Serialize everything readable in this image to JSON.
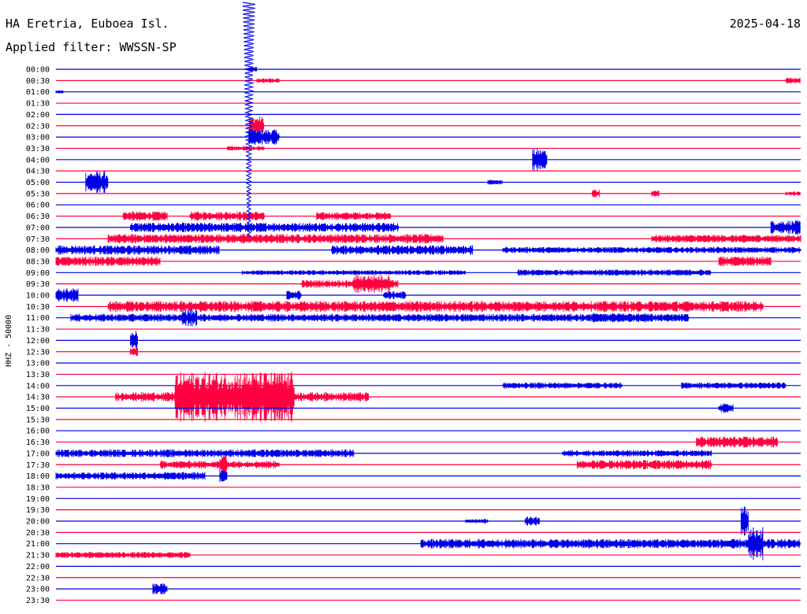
{
  "header": {
    "station": "HA Eretria, Euboea Isl.",
    "filter": "Applied filter: WWSSN-SP",
    "date": "2025-04-18"
  },
  "y_axis_label": "HHZ - 50000",
  "colors": {
    "even_trace": "#0000e6",
    "odd_trace": "#ff0040",
    "text": "#000000",
    "background": "#ffffff"
  },
  "chart_data": {
    "type": "line",
    "title": "HA Eretria, Euboea Isl.",
    "ylabel": "HHZ - 50000",
    "rows": [
      "00:00",
      "00:30",
      "01:00",
      "01:30",
      "02:00",
      "02:30",
      "03:00",
      "03:30",
      "04:00",
      "04:30",
      "05:00",
      "05:30",
      "06:00",
      "06:30",
      "07:00",
      "07:30",
      "08:00",
      "08:30",
      "09:00",
      "09:30",
      "10:00",
      "10:30",
      "11:00",
      "11:30",
      "12:00",
      "12:30",
      "13:00",
      "13:30",
      "14:00",
      "14:30",
      "15:00",
      "15:30",
      "16:00",
      "16:30",
      "17:00",
      "17:30",
      "18:00",
      "18:30",
      "19:00",
      "19:30",
      "20:00",
      "20:30",
      "21:00",
      "21:30",
      "22:00",
      "22:30",
      "23:00",
      "23:30"
    ],
    "trace_colors": [
      "#0000e6",
      "#ff0040"
    ],
    "events": [
      {
        "row": 0,
        "start": 0.26,
        "end": 0.27,
        "amp": 3
      },
      {
        "row": 1,
        "start": 0.27,
        "end": 0.3,
        "amp": 3
      },
      {
        "row": 1,
        "start": 0.98,
        "end": 1.0,
        "amp": 4
      },
      {
        "row": 2,
        "start": 0.0,
        "end": 0.01,
        "amp": 3
      },
      {
        "row": 5,
        "start": 0.26,
        "end": 0.28,
        "amp": 12
      },
      {
        "row": 6,
        "start": 0.26,
        "end": 0.3,
        "amp": 10
      },
      {
        "row": 7,
        "start": 0.23,
        "end": 0.28,
        "amp": 3
      },
      {
        "row": 8,
        "start": 0.64,
        "end": 0.66,
        "amp": 14
      },
      {
        "row": 10,
        "start": 0.04,
        "end": 0.07,
        "amp": 14
      },
      {
        "row": 10,
        "start": 0.58,
        "end": 0.6,
        "amp": 3
      },
      {
        "row": 11,
        "start": 0.72,
        "end": 0.73,
        "amp": 5
      },
      {
        "row": 11,
        "start": 0.8,
        "end": 0.81,
        "amp": 4
      },
      {
        "row": 11,
        "start": 0.98,
        "end": 1.0,
        "amp": 3
      },
      {
        "row": 13,
        "start": 0.09,
        "end": 0.15,
        "amp": 6
      },
      {
        "row": 13,
        "start": 0.18,
        "end": 0.28,
        "amp": 6
      },
      {
        "row": 13,
        "start": 0.35,
        "end": 0.45,
        "amp": 5
      },
      {
        "row": 14,
        "start": 0.1,
        "end": 0.46,
        "amp": 6
      },
      {
        "row": 14,
        "start": 0.96,
        "end": 1.0,
        "amp": 9
      },
      {
        "row": 15,
        "start": 0.07,
        "end": 0.52,
        "amp": 6
      },
      {
        "row": 15,
        "start": 0.8,
        "end": 1.0,
        "amp": 5
      },
      {
        "row": 16,
        "start": 0.0,
        "end": 0.22,
        "amp": 6
      },
      {
        "row": 16,
        "start": 0.37,
        "end": 0.56,
        "amp": 6
      },
      {
        "row": 16,
        "start": 0.6,
        "end": 1.0,
        "amp": 4
      },
      {
        "row": 17,
        "start": 0.0,
        "end": 0.14,
        "amp": 6
      },
      {
        "row": 17,
        "start": 0.89,
        "end": 0.96,
        "amp": 6
      },
      {
        "row": 18,
        "start": 0.25,
        "end": 0.55,
        "amp": 3
      },
      {
        "row": 18,
        "start": 0.62,
        "end": 0.88,
        "amp": 4
      },
      {
        "row": 19,
        "start": 0.33,
        "end": 0.46,
        "amp": 5
      },
      {
        "row": 19,
        "start": 0.4,
        "end": 0.45,
        "amp": 12
      },
      {
        "row": 20,
        "start": 0.0,
        "end": 0.03,
        "amp": 9
      },
      {
        "row": 20,
        "start": 0.31,
        "end": 0.33,
        "amp": 6
      },
      {
        "row": 20,
        "start": 0.44,
        "end": 0.47,
        "amp": 5
      },
      {
        "row": 21,
        "start": 0.07,
        "end": 0.95,
        "amp": 7
      },
      {
        "row": 22,
        "start": 0.02,
        "end": 0.85,
        "amp": 5
      },
      {
        "row": 22,
        "start": 0.17,
        "end": 0.19,
        "amp": 11
      },
      {
        "row": 22,
        "start": 0.72,
        "end": 0.8,
        "amp": 6
      },
      {
        "row": 24,
        "start": 0.1,
        "end": 0.11,
        "amp": 12
      },
      {
        "row": 25,
        "start": 0.1,
        "end": 0.11,
        "amp": 6
      },
      {
        "row": 28,
        "start": 0.6,
        "end": 0.76,
        "amp": 4
      },
      {
        "row": 28,
        "start": 0.84,
        "end": 0.98,
        "amp": 4
      },
      {
        "row": 29,
        "start": 0.08,
        "end": 0.42,
        "amp": 6
      },
      {
        "row": 29,
        "start": 0.16,
        "end": 0.32,
        "amp": 32
      },
      {
        "row": 30,
        "start": 0.89,
        "end": 0.91,
        "amp": 6
      },
      {
        "row": 33,
        "start": 0.86,
        "end": 0.97,
        "amp": 7
      },
      {
        "row": 34,
        "start": 0.0,
        "end": 0.4,
        "amp": 5
      },
      {
        "row": 34,
        "start": 0.68,
        "end": 0.88,
        "amp": 4
      },
      {
        "row": 35,
        "start": 0.14,
        "end": 0.3,
        "amp": 5
      },
      {
        "row": 35,
        "start": 0.22,
        "end": 0.23,
        "amp": 12
      },
      {
        "row": 35,
        "start": 0.7,
        "end": 0.88,
        "amp": 6
      },
      {
        "row": 36,
        "start": 0.0,
        "end": 0.2,
        "amp": 5
      },
      {
        "row": 36,
        "start": 0.22,
        "end": 0.23,
        "amp": 8
      },
      {
        "row": 40,
        "start": 0.55,
        "end": 0.58,
        "amp": 3
      },
      {
        "row": 40,
        "start": 0.63,
        "end": 0.65,
        "amp": 6
      },
      {
        "row": 40,
        "start": 0.92,
        "end": 0.93,
        "amp": 20
      },
      {
        "row": 42,
        "start": 0.49,
        "end": 1.0,
        "amp": 6
      },
      {
        "row": 42,
        "start": 0.93,
        "end": 0.95,
        "amp": 22
      },
      {
        "row": 43,
        "start": 0.0,
        "end": 0.18,
        "amp": 4
      },
      {
        "row": 46,
        "start": 0.13,
        "end": 0.15,
        "amp": 7
      }
    ],
    "big_quake": {
      "start_row": 0,
      "start": 0.259,
      "decay_rows": 7,
      "peak_amp": 110
    },
    "xlim": [
      0,
      1
    ]
  }
}
